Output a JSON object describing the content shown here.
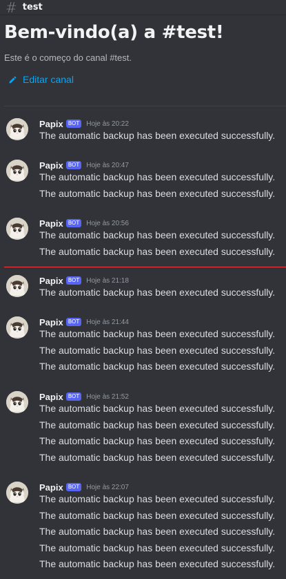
{
  "channel": {
    "name": "test",
    "welcome_title": "Bem-vindo(a) a #test!",
    "welcome_subtitle": "Este é o começo do canal #test.",
    "edit_label": "Editar canal"
  },
  "icons": {
    "channel": "hash-icon",
    "edit": "pencil-icon",
    "avatar": "cat-avatar"
  },
  "colors": {
    "link": "#00a8fc",
    "bot_badge": "#5865f2",
    "new_messages_divider": "#f23f43"
  },
  "messages": [
    {
      "author": "Papix",
      "badge": "BOT",
      "time": "Hoje às 20:22",
      "lines": [
        "The automatic backup has been executed successfully."
      ]
    },
    {
      "author": "Papix",
      "badge": "BOT",
      "time": "Hoje às 20:47",
      "lines": [
        "The automatic backup has been executed successfully.",
        "The automatic backup has been executed successfully."
      ]
    },
    {
      "author": "Papix",
      "badge": "BOT",
      "time": "Hoje às 20:56",
      "lines": [
        "The automatic backup has been executed successfully.",
        "The automatic backup has been executed successfully."
      ]
    },
    {
      "author": "Papix",
      "badge": "BOT",
      "time": "Hoje às 21:18",
      "lines": [
        "The automatic backup has been executed successfully."
      ]
    },
    {
      "author": "Papix",
      "badge": "BOT",
      "time": "Hoje às 21:44",
      "lines": [
        "The automatic backup has been executed successfully.",
        "The automatic backup has been executed successfully.",
        "The automatic backup has been executed successfully."
      ]
    },
    {
      "author": "Papix",
      "badge": "BOT",
      "time": "Hoje às 21:52",
      "lines": [
        "The automatic backup has been executed successfully.",
        "The automatic backup has been executed successfully.",
        "The automatic backup has been executed successfully.",
        "The automatic backup has been executed successfully."
      ]
    },
    {
      "author": "Papix",
      "badge": "BOT",
      "time": "Hoje às 22:07",
      "lines": [
        "The automatic backup has been executed successfully.",
        "The automatic backup has been executed successfully.",
        "The automatic backup has been executed successfully.",
        "The automatic backup has been executed successfully.",
        "The automatic backup has been executed successfully."
      ]
    }
  ]
}
